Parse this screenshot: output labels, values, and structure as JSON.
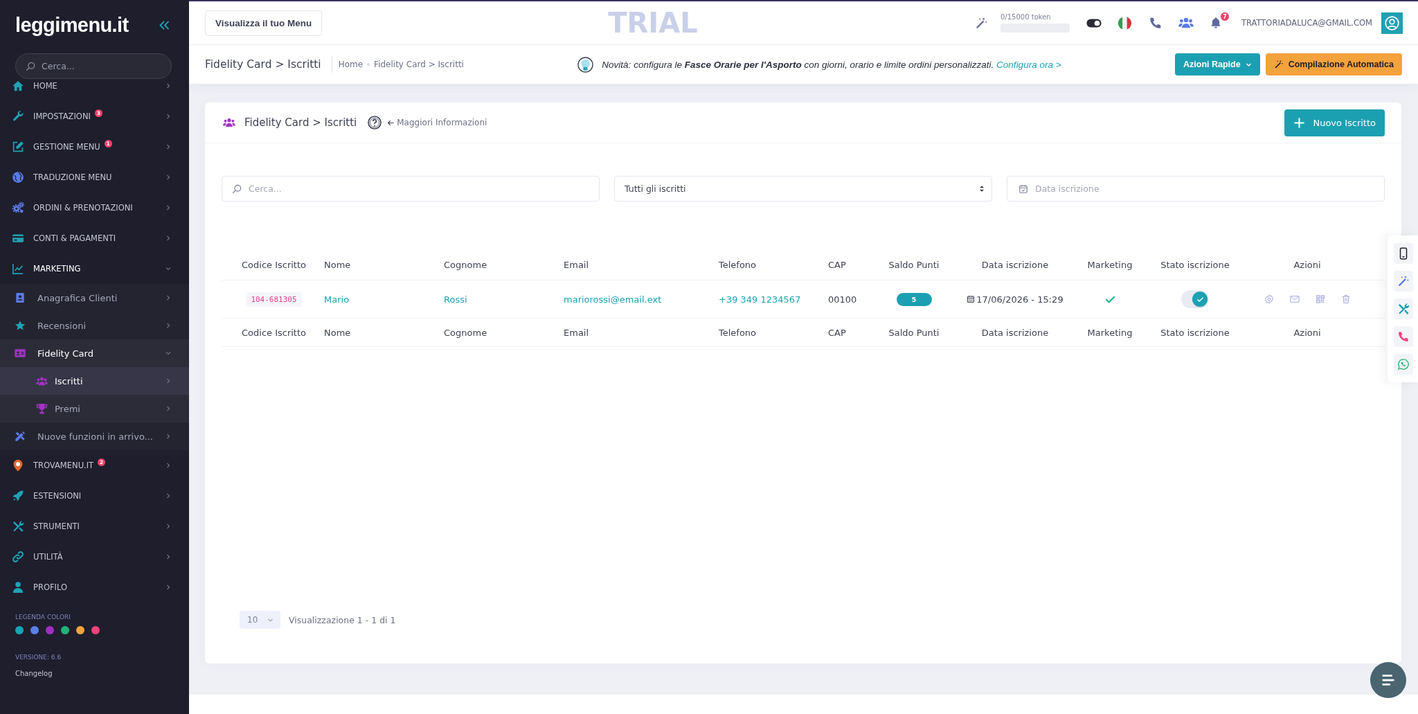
{
  "topbar": {
    "view_menu_button": "Visualizza il tuo Menu",
    "trial_label": "TRIAL",
    "token": {
      "label": "0/15000 token"
    },
    "notifications_count": "7",
    "user_email": "TRATTORIADALUCA@GMAIL.COM"
  },
  "sidebar": {
    "logo": "leggimenu.it",
    "search": {
      "placeholder": "Cerca..."
    },
    "items": [
      {
        "label": "HOME",
        "expanded": false,
        "selected": false
      },
      {
        "label": "IMPOSTAZIONI",
        "badge": "3",
        "expanded": false,
        "selected": false
      },
      {
        "label": "GESTIONE MENU",
        "badge": "1",
        "expanded": false,
        "selected": false
      },
      {
        "label": "TRADUZIONE MENU",
        "expanded": false,
        "selected": false
      },
      {
        "label": "ORDINI & PRENOTAZIONI",
        "expanded": false,
        "selected": false
      },
      {
        "label": "CONTI & PAGAMENTI",
        "expanded": false,
        "selected": false
      },
      {
        "label": "MARKETING",
        "expanded": true,
        "selected": false,
        "children": [
          {
            "label": "Anagrafica Clienti",
            "expanded": false,
            "selected": false
          },
          {
            "label": "Recensioni",
            "expanded": false,
            "selected": false
          },
          {
            "label": "Fidelity Card",
            "expanded": true,
            "selected": false,
            "children": [
              {
                "label": "Iscritti",
                "expanded": false,
                "selected": true
              },
              {
                "label": "Premi",
                "expanded": false,
                "selected": false
              }
            ]
          },
          {
            "label": "Nuove funzioni in arrivo...",
            "expanded": false,
            "selected": false
          }
        ]
      },
      {
        "label": "TROVAMENU.IT",
        "badge": "2",
        "expanded": false,
        "selected": false
      },
      {
        "label": "ESTENSIONI",
        "expanded": false,
        "selected": false
      },
      {
        "label": "STRUMENTI",
        "expanded": false,
        "selected": false
      },
      {
        "label": "UTILITÀ",
        "expanded": false,
        "selected": false
      },
      {
        "label": "PROFILO",
        "expanded": false,
        "selected": false
      }
    ],
    "legend": {
      "title": "LEGENDA COLORI",
      "colors": [
        {
          "color": "#1aa3b5"
        },
        {
          "color": "#5d7ee8"
        },
        {
          "color": "#a02fc0"
        },
        {
          "color": "#21b27a"
        },
        {
          "color": "#f4a43a"
        },
        {
          "color": "#f0417a"
        }
      ]
    },
    "version": "VERSIONE: 6.6",
    "changelog_link": "Changelog"
  },
  "subheader": {
    "title": "Fidelity Card > Iscritti",
    "breadcrumb": [
      "Home",
      "Fidelity Card > Iscritti"
    ],
    "notice": {
      "text": "Novità: configura le **Fasce Orarie per l'Asporto** con giorni, orario e limite ordini personalizzati.",
      "link": "Configura ora >"
    },
    "quick_actions_button": "Azioni Rapide",
    "auto_fill_button": "Compilazione Automatica"
  },
  "card": {
    "title": "Fidelity Card > Iscritti",
    "info_link": "Maggiori Informazioni",
    "new_button": "Nuovo Iscritto",
    "filters": {
      "search": {
        "placeholder": "Cerca..."
      },
      "status_select": {
        "value": "Tutti gli iscritti"
      },
      "date": {
        "placeholder": "Data iscrizione"
      }
    },
    "table": {
      "columns": [
        "Codice Iscritto",
        "Nome",
        "Cognome",
        "Email",
        "Telefono",
        "CAP",
        "Saldo Punti",
        "Data iscrizione",
        "Marketing",
        "Stato iscrizione",
        "Azioni"
      ],
      "rows": [
        {
          "code": "104-681305",
          "first_name": "Mario",
          "last_name": "Rossi",
          "email": "mariorossi@email.ext",
          "phone": "+39 349 1234567",
          "cap": "00100",
          "points": "5",
          "date": "17/06/2026 - 15:29",
          "marketing": true,
          "active": true
        }
      ],
      "footer_columns": [
        "Codice Iscritto",
        "Nome",
        "Cognome",
        "Email",
        "Telefono",
        "CAP",
        "Saldo Punti",
        "Data iscrizione",
        "Marketing",
        "Stato iscrizione",
        "Azioni"
      ]
    },
    "pagination": {
      "page_size": "10",
      "summary": "Visualizzazione 1 - 1 di 1"
    }
  }
}
